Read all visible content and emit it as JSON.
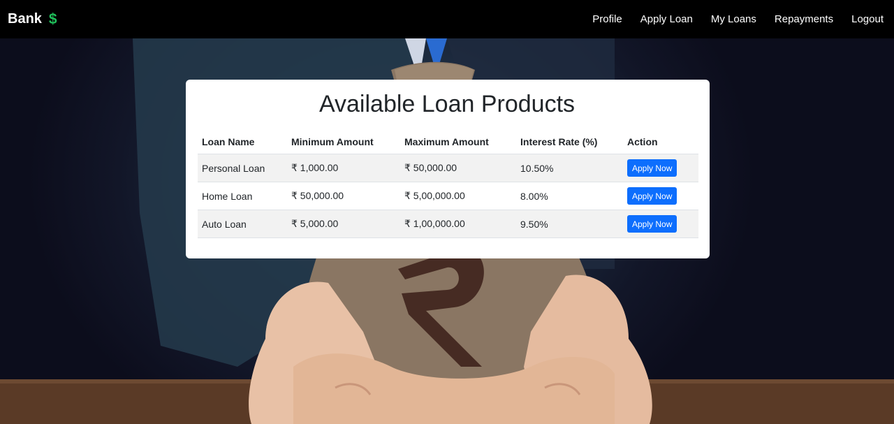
{
  "navbar": {
    "brand": "Bank",
    "brand_icon": "$",
    "links": [
      "Profile",
      "Apply Loan",
      "My Loans",
      "Repayments",
      "Logout"
    ]
  },
  "main": {
    "title": "Available Loan Products",
    "table": {
      "headers": [
        "Loan Name",
        "Minimum Amount",
        "Maximum Amount",
        "Interest Rate (%)",
        "Action"
      ],
      "rows": [
        {
          "name": "Personal Loan",
          "min": "₹ 1,000.00",
          "max": "₹ 50,000.00",
          "rate": "10.50%",
          "action": "Apply Now"
        },
        {
          "name": "Home Loan",
          "min": "₹ 50,000.00",
          "max": "₹ 5,00,000.00",
          "rate": "8.00%",
          "action": "Apply Now"
        },
        {
          "name": "Auto Loan",
          "min": "₹ 5,000.00",
          "max": "₹ 1,00,000.00",
          "rate": "9.50%",
          "action": "Apply Now"
        }
      ]
    }
  },
  "colors": {
    "navbar_bg": "#000000",
    "brand_icon": "#1fbf5a",
    "button": "#0d6efd"
  }
}
